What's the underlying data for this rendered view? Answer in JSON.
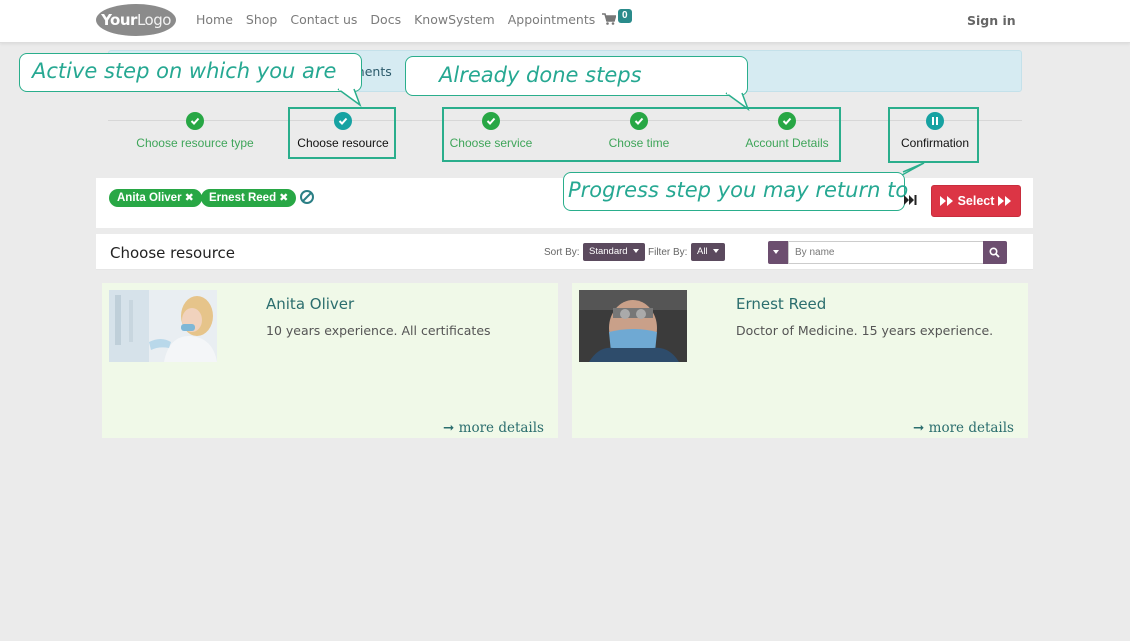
{
  "navbar": {
    "logo_bold": "Your",
    "logo_light": "Logo",
    "links": [
      "Home",
      "Shop",
      "Contact us",
      "Docs",
      "KnowSystem",
      "Appointments"
    ],
    "cart_count": "0",
    "signin": "Sign in"
  },
  "info_strip_text": "atments",
  "steps": [
    {
      "label": "Choose resource type",
      "state": "done"
    },
    {
      "label": "Choose resource",
      "state": "active"
    },
    {
      "label": "Choose service",
      "state": "done"
    },
    {
      "label": "Chose time",
      "state": "done"
    },
    {
      "label": "Account Details",
      "state": "done"
    },
    {
      "label": "Confirmation",
      "state": "pending"
    }
  ],
  "annotations": {
    "active": "Active step on which you are",
    "done": "Already done steps",
    "return": "Progress step you may return to"
  },
  "selected_tags": [
    "Anita Oliver",
    "Ernest Reed"
  ],
  "select_button": "Select",
  "resource_header": {
    "title": "Choose resource",
    "sort_label": "Sort By:",
    "sort_value": "Standard",
    "filter_label": "Filter By:",
    "filter_value": "All",
    "search_placeholder": "By name"
  },
  "resources": [
    {
      "name": "Anita Oliver",
      "description": "10 years experience. All certificates",
      "more": "more details"
    },
    {
      "name": "Ernest Reed",
      "description": "Doctor of Medicine. 15 years experience.",
      "more": "more details"
    }
  ],
  "colors": {
    "done_green": "#28a745",
    "active_teal": "#17a2a2",
    "annotation": "#2aae8c",
    "select_red": "#dc3545",
    "card_bg": "#f0f9e8"
  }
}
